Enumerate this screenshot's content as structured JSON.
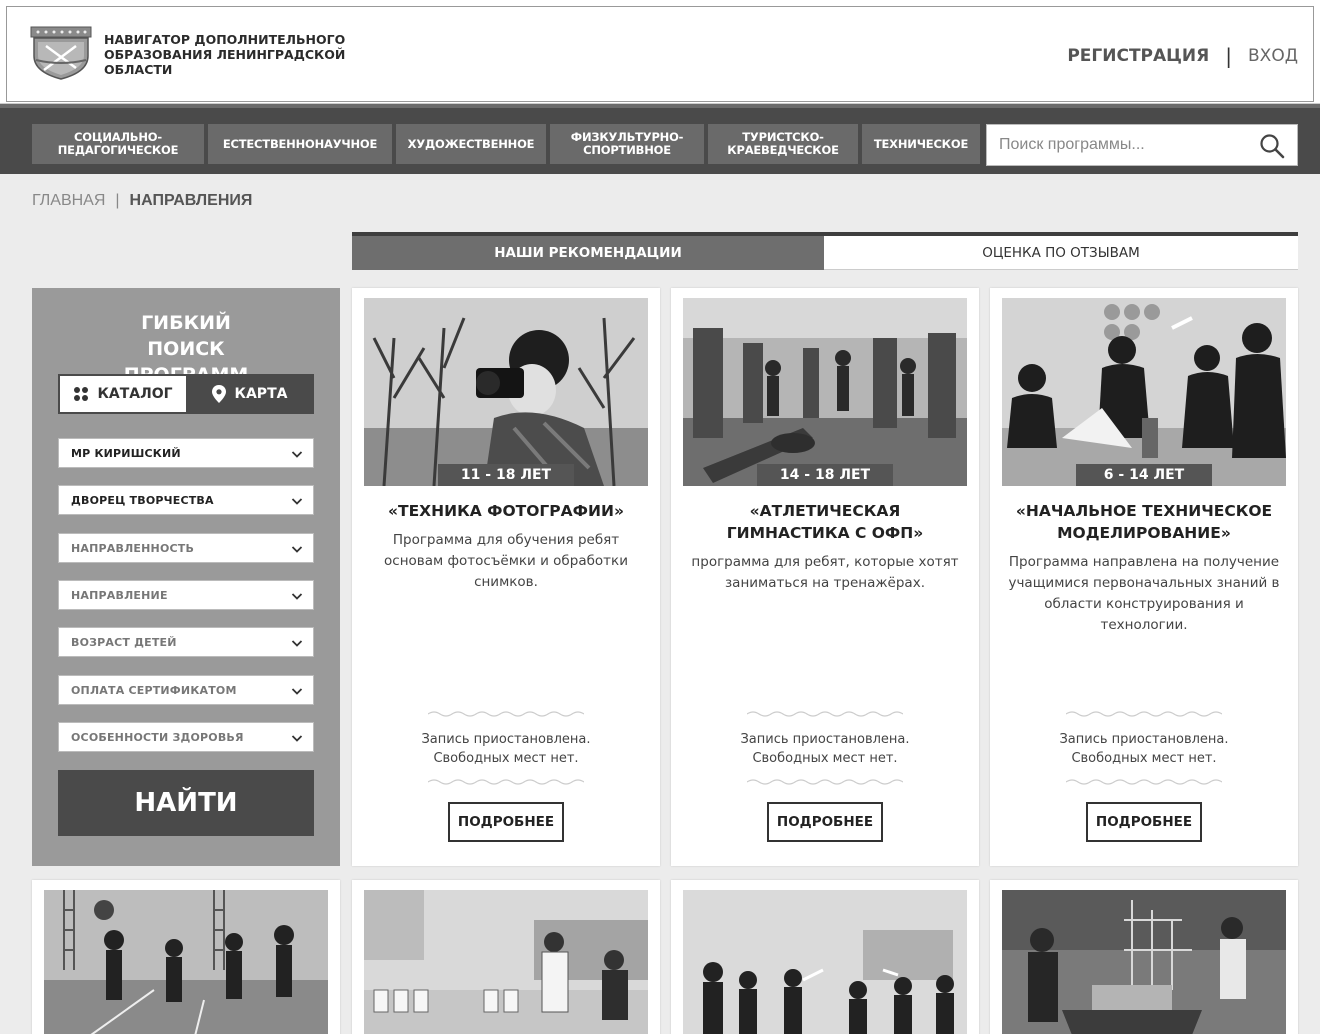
{
  "header": {
    "brand_text": "НАВИГАТОР ДОПОЛНИТЕЛЬНОГО ОБРАЗОВАНИЯ ЛЕНИНГРАДСКОЙ ОБЛАСТИ",
    "register_label": "РЕГИСТРАЦИЯ",
    "separator": "|",
    "login_label": "ВХОД"
  },
  "nav": {
    "items": [
      {
        "label": "СОЦИАЛЬНО-ПЕДАГОГИЧЕСКОЕ"
      },
      {
        "label": "ЕСТЕСТВЕННОНАУЧНОЕ"
      },
      {
        "label": "ХУДОЖЕСТВЕННОЕ"
      },
      {
        "label": "ФИЗКУЛЬТУРНО-СПОРТИВНОЕ"
      },
      {
        "label": "ТУРИСТСКО-КРАЕВЕДЧЕСКОЕ"
      },
      {
        "label": "ТЕХНИЧЕСКОЕ"
      }
    ],
    "search_placeholder": "Поиск программы..."
  },
  "breadcrumb": {
    "home": "ГЛАВНАЯ",
    "separator": "|",
    "current": "НАПРАВЛЕНИЯ"
  },
  "tabs": [
    {
      "label": "НАШИ РЕКОМЕНДАЦИИ"
    },
    {
      "label": "ОЦЕНКА ПО ОТЗЫВАМ"
    }
  ],
  "filter": {
    "title": "ГИБКИЙ ПОИСК ПРОГРАММ",
    "catalog_label": "КАТАЛОГ",
    "map_label": "КАРТА",
    "selects": [
      {
        "value": "МР КИРИШСКИЙ"
      },
      {
        "value": "ДВОРЕЦ ТВОРЧЕСТВА"
      },
      {
        "value": "НАПРАВЛЕННОСТЬ"
      },
      {
        "value": "НАПРАВЛЕНИЕ"
      },
      {
        "value": "ВОЗРАСТ ДЕТЕЙ"
      },
      {
        "value": "ОПЛАТА СЕРТИФИКАТОМ"
      },
      {
        "value": "ОСОБЕННОСТИ ЗДОРОВЬЯ"
      }
    ],
    "find_label": "НАЙТИ"
  },
  "cards": [
    {
      "age": "11 - 18 ЛЕТ",
      "title": "«ТЕХНИКА ФОТОГРАФИИ»",
      "description": "Программа для обучения ребят основам фотосъёмки и обработки снимков.",
      "status_1": "Запись приостановлена.",
      "status_2": "Свободных мест нет.",
      "more_label": "ПОДРОБНЕЕ"
    },
    {
      "age": "14 - 18 ЛЕТ",
      "title": "«АТЛЕТИЧЕСКАЯ ГИМНАСТИКА С ОФП»",
      "description": "программа для ребят, которые хотят заниматься на тренажёрах.",
      "status_1": "Запись приостановлена.",
      "status_2": "Свободных мест нет.",
      "more_label": "ПОДРОБНЕЕ"
    },
    {
      "age": "6 - 14 ЛЕТ",
      "title": "«НАЧАЛЬНОЕ ТЕХНИЧЕСКОЕ МОДЕЛИРОВАНИЕ»",
      "description": "Программа направлена на получение учащимися первоначальных знаний в области конструирования и технологии.",
      "status_1": "Запись приостановлена.",
      "status_2": "Свободных мест нет.",
      "more_label": "ПОДРОБНЕЕ"
    }
  ]
}
